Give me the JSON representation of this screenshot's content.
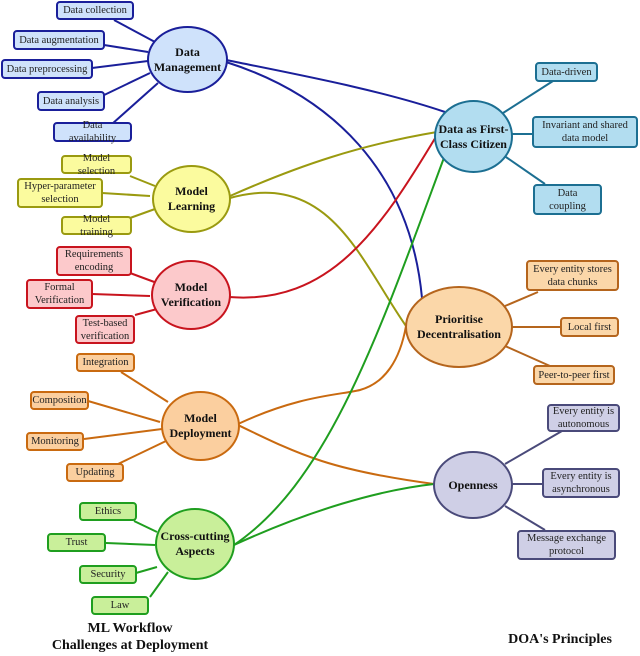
{
  "left_caption": [
    "ML Workflow",
    "Challenges at Deployment"
  ],
  "right_caption": "DOA's Principles",
  "colors": {
    "data_management": "#1a1f9a",
    "model_learning": "#9a9a10",
    "model_verification": "#c8141e",
    "model_deployment": "#c96a10",
    "cross_cutting": "#1f9e1f",
    "data_first_class": "#1c6f92",
    "decentralisation": "#b5651d",
    "openness": "#4a4a7a"
  },
  "challenges": [
    {
      "id": "dm",
      "label": "Data Management",
      "lines": [
        "Data",
        "Management"
      ],
      "items": [
        "Data collection",
        "Data augmentation",
        "Data preprocessing",
        "Data analysis",
        "Data availability"
      ]
    },
    {
      "id": "ml",
      "label": "Model Learning",
      "lines": [
        "Model",
        "Learning"
      ],
      "items": [
        "Model selection",
        "Hyper-parameter selection",
        "Model training"
      ]
    },
    {
      "id": "mv",
      "label": "Model Verification",
      "lines": [
        "Model",
        "Verification"
      ],
      "items": [
        "Requirements encoding",
        "Formal Verification",
        "Test-based verification"
      ]
    },
    {
      "id": "md",
      "label": "Model Deployment",
      "lines": [
        "Model",
        "Deployment"
      ],
      "items": [
        "Integration",
        "Composition",
        "Monitoring",
        "Updating"
      ]
    },
    {
      "id": "ca",
      "label": "Cross-cutting Aspects",
      "lines": [
        "Cross-cutting",
        "Aspects"
      ],
      "items": [
        "Ethics",
        "Trust",
        "Security",
        "Law"
      ]
    }
  ],
  "principles": [
    {
      "id": "dfc",
      "label": "Data as First-Class Citizen",
      "lines": [
        "Data as First-",
        "Class Citizen"
      ],
      "items": [
        "Data-driven",
        "Invariant and shared data model",
        "Data coupling"
      ]
    },
    {
      "id": "pd",
      "label": "Prioritise Decentralisation",
      "lines": [
        "Prioritise",
        "Decentralisation"
      ],
      "items": [
        "Every entity stores data chunks",
        "Local first",
        "Peer-to-peer first"
      ]
    },
    {
      "id": "op",
      "label": "Openness",
      "lines": [
        "Openness"
      ],
      "items": [
        "Every entity is autonomous",
        "Every entity is asynchronous",
        "Message exchange protocol"
      ]
    }
  ],
  "links": [
    {
      "from": "Data Management",
      "to": "Data as First-Class Citizen"
    },
    {
      "from": "Data Management",
      "to": "Prioritise Decentralisation"
    },
    {
      "from": "Model Learning",
      "to": "Data as First-Class Citizen"
    },
    {
      "from": "Model Learning",
      "to": "Prioritise Decentralisation"
    },
    {
      "from": "Model Verification",
      "to": "Data as First-Class Citizen"
    },
    {
      "from": "Model Deployment",
      "to": "Prioritise Decentralisation"
    },
    {
      "from": "Model Deployment",
      "to": "Openness"
    },
    {
      "from": "Cross-cutting Aspects",
      "to": "Data as First-Class Citizen"
    },
    {
      "from": "Cross-cutting Aspects",
      "to": "Openness"
    }
  ]
}
